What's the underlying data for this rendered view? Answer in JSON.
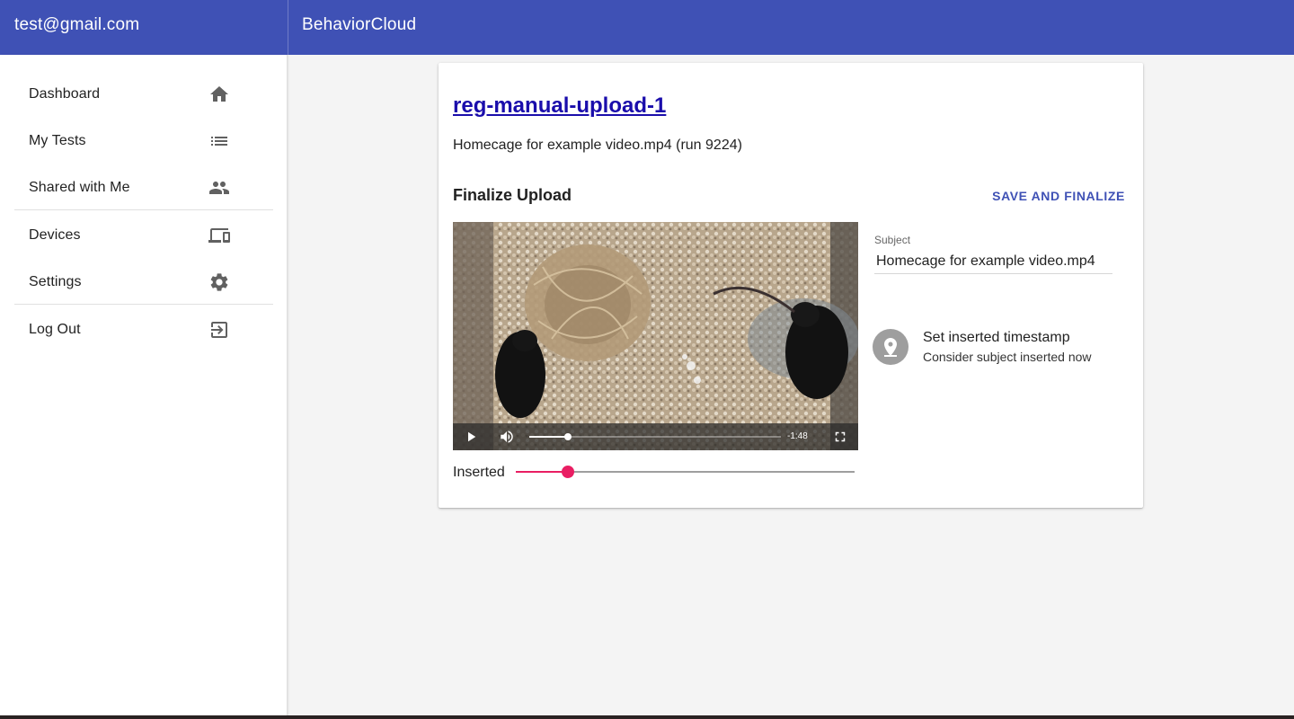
{
  "appbar": {
    "user_email": "test@gmail.com",
    "title": "BehaviorCloud",
    "color": "#3f51b5"
  },
  "sidebar": {
    "items": [
      {
        "label": "Dashboard",
        "icon": "home-icon"
      },
      {
        "label": "My Tests",
        "icon": "list-icon"
      },
      {
        "label": "Shared with Me",
        "icon": "people-icon"
      },
      {
        "label": "Devices",
        "icon": "devices-icon"
      },
      {
        "label": "Settings",
        "icon": "gear-icon"
      },
      {
        "label": "Log Out",
        "icon": "logout-icon"
      }
    ]
  },
  "main": {
    "test_link": "reg-manual-upload-1",
    "subtitle": "Homecage for example video.mp4 (run 9224)",
    "section_title": "Finalize Upload",
    "save_button": "SAVE AND FINALIZE",
    "video": {
      "time_remaining": "-1:48",
      "progress_fraction": 0.155,
      "controls": [
        "play-icon",
        "volume-icon",
        "fullscreen-icon"
      ]
    },
    "slider": {
      "label": "Inserted",
      "value_fraction": 0.155,
      "accent": "#e91e63"
    },
    "subject": {
      "label": "Subject",
      "value": "Homecage for example video.mp4"
    },
    "timestamp": {
      "primary": "Set inserted timestamp",
      "secondary": "Consider subject inserted now",
      "icon": "location-pin-icon"
    }
  }
}
